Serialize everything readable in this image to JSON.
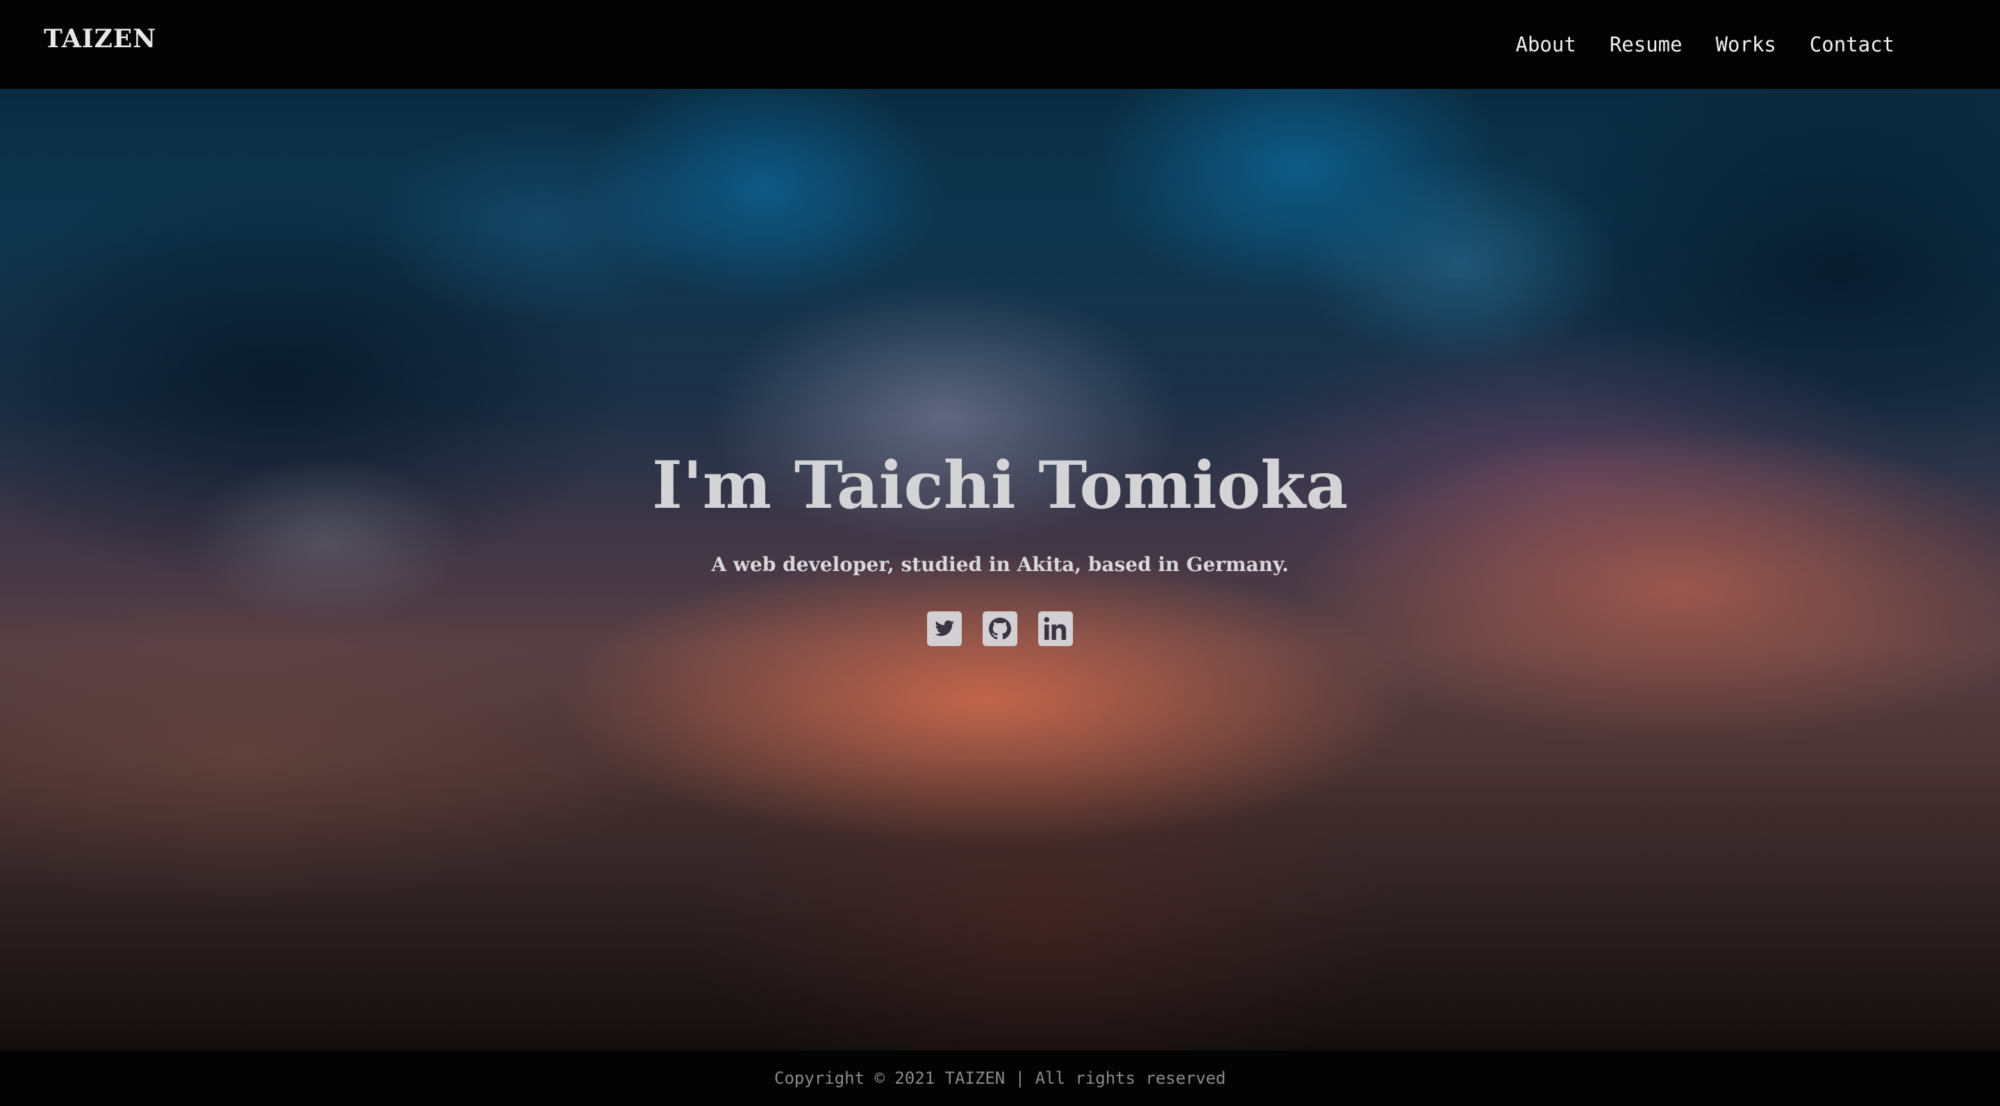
{
  "header": {
    "logo": "TAIZEN",
    "nav": [
      {
        "label": "About"
      },
      {
        "label": "Resume"
      },
      {
        "label": "Works"
      },
      {
        "label": "Contact"
      }
    ]
  },
  "hero": {
    "title": "I'm Taichi Tomioka",
    "subtitle": "A web developer, studied in Akita, based in Germany.",
    "social": [
      {
        "icon": "twitter-icon"
      },
      {
        "icon": "github-icon"
      },
      {
        "icon": "linkedin-icon"
      }
    ]
  },
  "footer": {
    "copyright": "Copyright © 2021 TAIZEN | All rights reserved"
  },
  "colors": {
    "header_bg": "#030303",
    "text_light": "#d4d3d6",
    "footer_text": "#8a8a8a"
  }
}
